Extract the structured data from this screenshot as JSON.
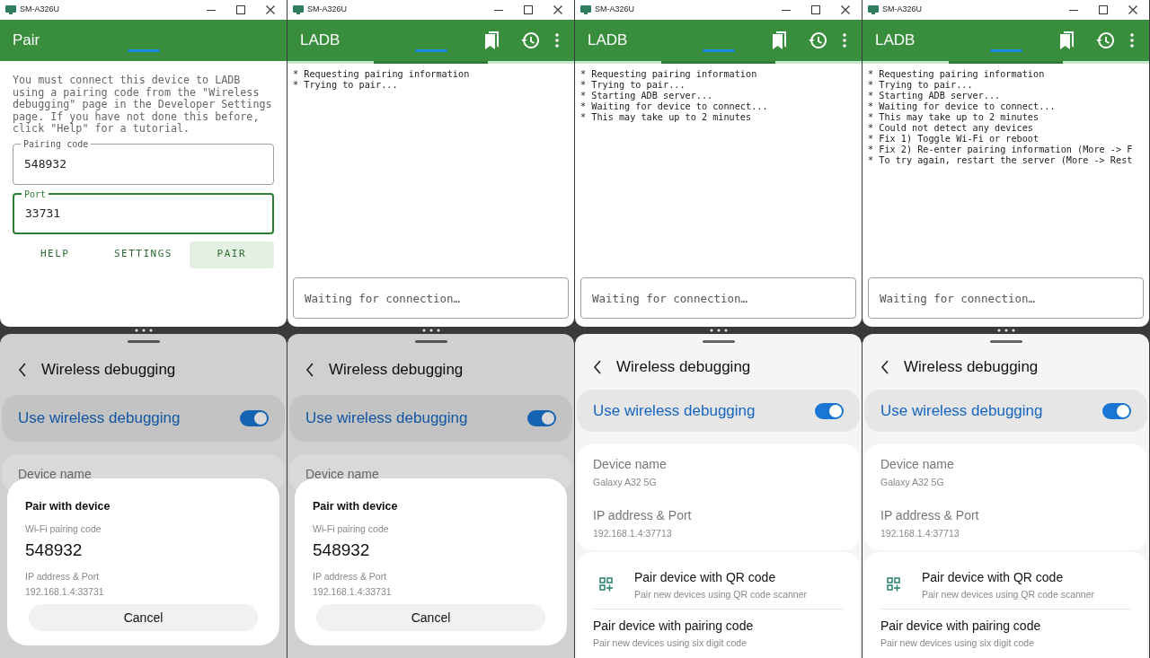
{
  "panels": [
    {
      "window_title": "SM-A326U",
      "app_bar": {
        "title": "Pair",
        "actions": false
      },
      "busy": false,
      "pair_form": {
        "intro": "You must connect this device to LADB using a pairing code from the \"Wireless debugging\" page in the Developer Settings page. If you have not done this before, click \"Help\" for a tutorial.",
        "fields": [
          {
            "label": "Pairing code",
            "value": "548932",
            "focused": false
          },
          {
            "label": "Port",
            "value": "33731",
            "focused": true
          }
        ],
        "buttons": [
          {
            "label": "HELP",
            "highlighted": false
          },
          {
            "label": "SETTINGS",
            "highlighted": false
          },
          {
            "label": "PAIR",
            "highlighted": true
          }
        ]
      },
      "settings": {
        "title": "Wireless debugging",
        "toggle": {
          "label": "Use wireless debugging",
          "on": true
        },
        "info": [
          {
            "label": "Device name"
          }
        ],
        "dialog": {
          "title": "Pair with device",
          "code_label": "Wi-Fi pairing code",
          "code": "548932",
          "ip_label": "IP address & Port",
          "ip": "192.168.1.4:33731",
          "button": "Cancel"
        }
      }
    },
    {
      "window_title": "SM-A326U",
      "app_bar": {
        "title": "LADB",
        "actions": true
      },
      "busy": true,
      "log": [
        "* Requesting pairing information",
        "* Trying to pair..."
      ],
      "command_placeholder": "Waiting for connection…",
      "settings": {
        "title": "Wireless debugging",
        "toggle": {
          "label": "Use wireless debugging",
          "on": true
        },
        "info": [
          {
            "label": "Device name"
          }
        ],
        "dialog": {
          "title": "Pair with device",
          "code_label": "Wi-Fi pairing code",
          "code": "548932",
          "ip_label": "IP address & Port",
          "ip": "192.168.1.4:33731",
          "button": "Cancel"
        }
      }
    },
    {
      "window_title": "SM-A326U",
      "app_bar": {
        "title": "LADB",
        "actions": true
      },
      "busy": true,
      "log": [
        "* Requesting pairing information",
        "* Trying to pair...",
        "* Starting ADB server...",
        "* Waiting for device to connect...",
        "* This may take up to 2 minutes"
      ],
      "command_placeholder": "Waiting for connection…",
      "settings": {
        "title": "Wireless debugging",
        "toggle": {
          "label": "Use wireless debugging",
          "on": true
        },
        "info": [
          {
            "label": "Device name",
            "value": "Galaxy A32 5G"
          },
          {
            "label": "IP address & Port",
            "value": "192.168.1.4:37713"
          }
        ],
        "items": [
          {
            "kind": "qr",
            "title": "Pair device with QR code",
            "subtitle": "Pair new devices using QR code scanner"
          },
          {
            "kind": "plain",
            "title": "Pair device with pairing code",
            "subtitle": "Pair new devices using six digit code"
          }
        ]
      }
    },
    {
      "window_title": "SM-A326U",
      "app_bar": {
        "title": "LADB",
        "actions": true
      },
      "busy": true,
      "log": [
        "* Requesting pairing information",
        "* Trying to pair...",
        "* Starting ADB server...",
        "* Waiting for device to connect...",
        "* This may take up to 2 minutes",
        "* Could not detect any devices",
        "* Fix 1) Toggle Wi-Fi or reboot",
        "* Fix 2) Re-enter pairing information (More -> F",
        "* To try again, restart the server (More -> Rest"
      ],
      "command_placeholder": "Waiting for connection…",
      "settings": {
        "title": "Wireless debugging",
        "toggle": {
          "label": "Use wireless debugging",
          "on": true
        },
        "info": [
          {
            "label": "Device name",
            "value": "Galaxy A32 5G"
          },
          {
            "label": "IP address & Port",
            "value": "192.168.1.4:37713"
          }
        ],
        "items": [
          {
            "kind": "qr",
            "title": "Pair device with QR code",
            "subtitle": "Pair new devices using QR code scanner"
          },
          {
            "kind": "plain",
            "title": "Pair device with pairing code",
            "subtitle": "Pair new devices using six digit code"
          }
        ]
      }
    }
  ]
}
